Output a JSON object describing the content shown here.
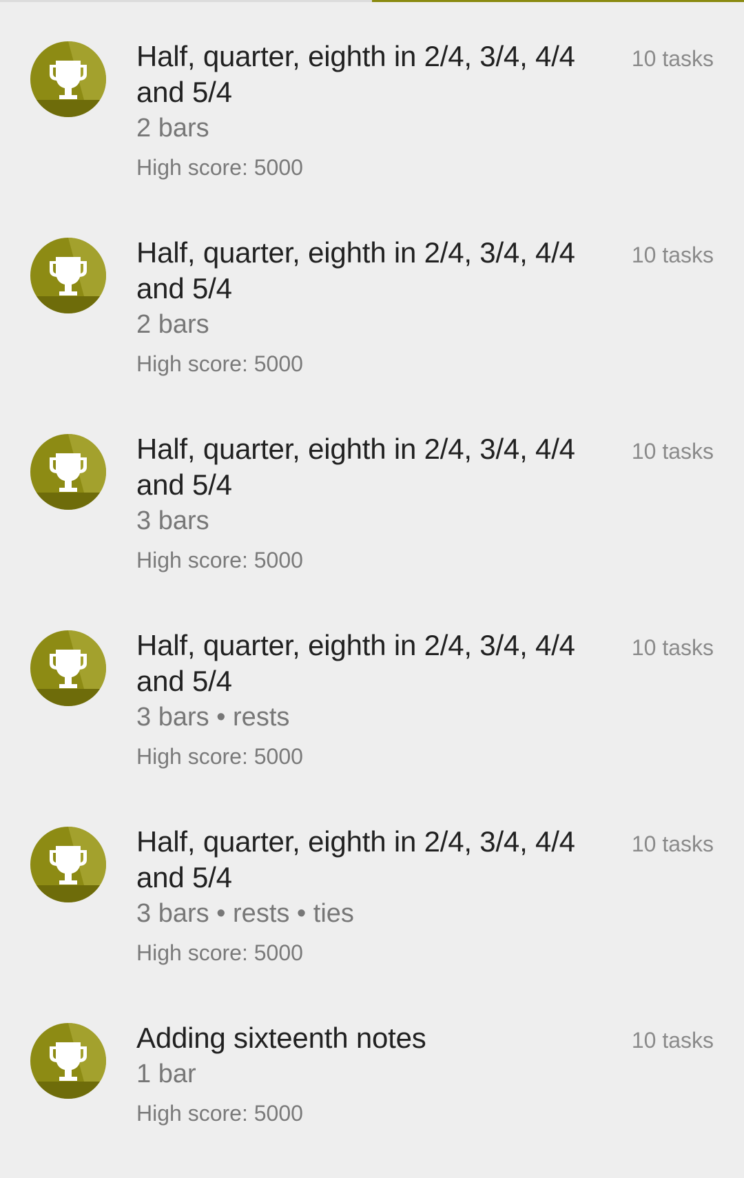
{
  "colors": {
    "accent": "#8a8a10",
    "badge_light": "#a3a12d",
    "badge_dark": "#6e6c0a",
    "background": "#eeeeee"
  },
  "icons": {
    "badge": "trophy-icon"
  },
  "lessons": [
    {
      "title": "Half, quarter, eighth in 2/4, 3/4, 4/4 and 5/4",
      "subtitle": "2 bars",
      "high_score": "High score: 5000",
      "tasks": "10 tasks"
    },
    {
      "title": "Half, quarter, eighth in 2/4, 3/4, 4/4 and 5/4",
      "subtitle": "2 bars",
      "high_score": "High score: 5000",
      "tasks": "10 tasks"
    },
    {
      "title": "Half, quarter, eighth in 2/4, 3/4, 4/4 and 5/4",
      "subtitle": "3 bars",
      "high_score": "High score: 5000",
      "tasks": "10 tasks"
    },
    {
      "title": "Half, quarter, eighth in 2/4, 3/4, 4/4 and 5/4",
      "subtitle": "3 bars • rests",
      "high_score": "High score: 5000",
      "tasks": "10 tasks"
    },
    {
      "title": "Half, quarter, eighth in 2/4, 3/4, 4/4 and 5/4",
      "subtitle": "3 bars • rests • ties",
      "high_score": "High score: 5000",
      "tasks": "10 tasks"
    },
    {
      "title": "Adding sixteenth notes",
      "subtitle": "1 bar",
      "high_score": "High score: 5000",
      "tasks": "10 tasks"
    }
  ]
}
